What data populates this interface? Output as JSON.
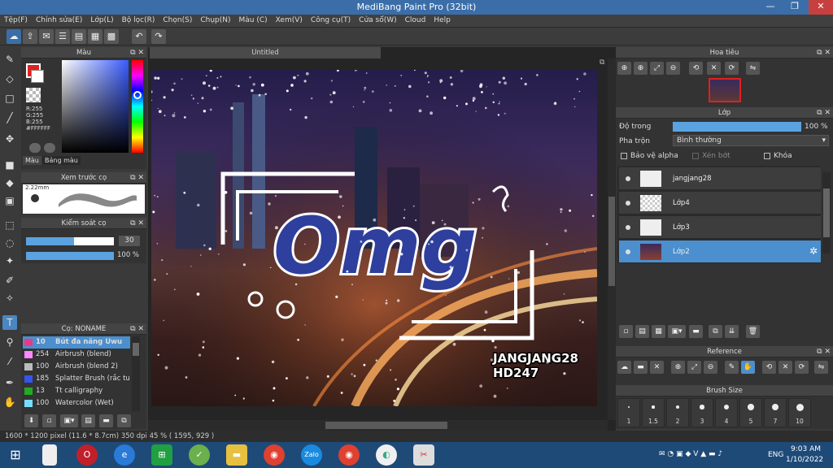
{
  "window": {
    "title": "MediBang Paint Pro (32bit)",
    "min": "—",
    "max": "❐",
    "close": "✕"
  },
  "menu": [
    "Tệp(F)",
    "Chỉnh sửa(E)",
    "Lớp(L)",
    "Bộ lọc(R)",
    "Chọn(S)",
    "Chụp(N)",
    "Màu (C)",
    "Xem(V)",
    "Công cụ(T)",
    "Cửa sổ(W)",
    "Cloud",
    "Help"
  ],
  "color_panel": {
    "title": "Màu",
    "readout": "R:255\nG:255\nB:255\n#FFFFFF",
    "tabs": [
      "Màu",
      "Bảng màu"
    ]
  },
  "brush_preview": {
    "title": "Xem trước cọ",
    "size": "2.22mm"
  },
  "brush_control": {
    "title": "Kiểm soát cọ",
    "size_value": "30",
    "opacity_value": "100 %",
    "size_fraction": 0.55,
    "opacity_fraction": 1.0
  },
  "brush_list": {
    "title": "Cọ: NONAME",
    "items": [
      {
        "size": "10",
        "name": "Bút đa năng Uwu",
        "color": "#e83a8a",
        "selected": true
      },
      {
        "size": "254",
        "name": "Airbrush (blend)",
        "color": "#ff88ff"
      },
      {
        "size": "100",
        "name": "Airbrush (blend 2)",
        "color": "#bbbbbb"
      },
      {
        "size": "185",
        "name": "Splatter Brush (rắc tuy",
        "color": "#3355ee"
      },
      {
        "size": "13",
        "name": "Tt calligraphy",
        "color": "#22aa22"
      },
      {
        "size": "100",
        "name": "Watercolor (Wet)",
        "color": "#77ddff"
      }
    ]
  },
  "document": {
    "tab": "Untitled"
  },
  "canvas_art": {
    "word": "Omg",
    "watermark_line1": "JANGJANG28",
    "watermark_line2": "HD247"
  },
  "navigator": {
    "title": "Hoa tiêu"
  },
  "layer_panel": {
    "title": "Lớp",
    "opacity_label": "Độ trong",
    "opacity_value": "100 %",
    "opacity_fraction": 1.0,
    "blend_label": "Pha trộn",
    "blend_value": "Bình thường",
    "protect_alpha": "Bảo vệ alpha",
    "clip": "Xén bớt",
    "lock": "Khóa",
    "layers": [
      {
        "name": "jangjang28",
        "selected": false
      },
      {
        "name": "Lớp4",
        "selected": false
      },
      {
        "name": "Lớp3",
        "selected": false
      },
      {
        "name": "Lớp2",
        "selected": true
      }
    ]
  },
  "reference": {
    "title": "Reference"
  },
  "brush_size": {
    "title": "Brush Size",
    "sizes": [
      "1",
      "1.5",
      "2",
      "3",
      "4",
      "5",
      "7",
      "10"
    ]
  },
  "status": {
    "text": "1600 * 1200 pixel  (11.6 * 8.7cm)  350 dpi  45 %  ( 1595, 929 )"
  },
  "taskbar": {
    "lang": "ENG",
    "time": "9:03 AM",
    "date": "1/10/2022"
  },
  "colors": {
    "accent": "#4c8fce",
    "title": "#3b6ea8",
    "fg_color": "#e02020"
  }
}
